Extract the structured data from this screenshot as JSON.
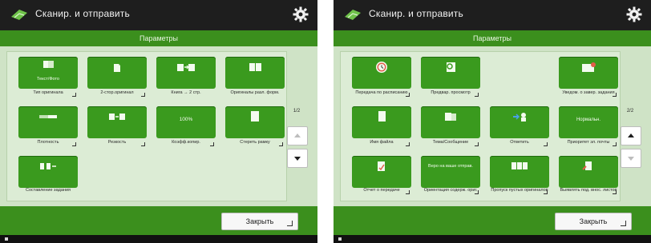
{
  "left": {
    "title": "Сканир. и отправить",
    "subtitle": "Параметры",
    "page": "1/2",
    "close": "Закрыть",
    "buttons": [
      {
        "label": "Текст/Фото",
        "caption": "Тип оригинала",
        "icon": "document-type-icon",
        "tick": true
      },
      {
        "label": "",
        "caption": "2-стор.оригинал",
        "icon": "two-sided-original-icon",
        "tick": true
      },
      {
        "label": "",
        "caption": "Книга → 2 стр.",
        "icon": "book-to-two-pages-icon",
        "tick": false
      },
      {
        "label": "",
        "caption": "Оригиналы разл. форм.",
        "icon": "mixed-size-originals-icon",
        "tick": false
      },
      {
        "label": "",
        "caption": "Плотность",
        "icon": "density-icon",
        "tick": true
      },
      {
        "label": "",
        "caption": "Резкость",
        "icon": "sharpness-icon",
        "tick": true
      },
      {
        "label": "100%",
        "caption": "Коэфф.копир.",
        "icon": "zoom-ratio-icon",
        "tick": true
      },
      {
        "label": "",
        "caption": "Стереть рамку",
        "icon": "erase-frame-icon",
        "tick": true
      },
      {
        "label": "",
        "caption": "Составление задания",
        "icon": "job-build-icon",
        "tick": false
      }
    ]
  },
  "right": {
    "title": "Сканир. и отправить",
    "subtitle": "Параметры",
    "page": "2/2",
    "close": "Закрыть",
    "buttons": [
      {
        "label": "",
        "caption": "Передача по расписанию",
        "icon": "clock-icon",
        "tick": true
      },
      {
        "label": "",
        "caption": "Предвар. просмотр",
        "icon": "preview-icon",
        "tick": true
      },
      {
        "label": "",
        "caption": "Уведом. о завер. задания",
        "icon": "notify-icon",
        "tick": true
      },
      {
        "label": "",
        "caption": "Имя файла",
        "icon": "filename-icon",
        "tick": true
      },
      {
        "label": "",
        "caption": "Тема/Сообщение",
        "icon": "subject-message-icon",
        "tick": true
      },
      {
        "label": "",
        "caption": "Ответить",
        "icon": "reply-icon",
        "tick": true
      },
      {
        "label": "Нормальн.",
        "caption": "Приоритет эл. почты",
        "icon": "priority-icon",
        "tick": true
      },
      {
        "label": "",
        "caption": "Отчет о передаче",
        "icon": "tx-report-icon",
        "tick": true
      },
      {
        "label": "Веро на ваше отправ.",
        "caption": "Ориентация содерж. ориг.",
        "icon": "orientation-icon",
        "tick": true
      },
      {
        "label": "",
        "caption": "Пропуск пустых оригиналов",
        "icon": "skip-blank-icon",
        "tick": true
      },
      {
        "label": "",
        "caption": "Выявлять под. внос. листов",
        "icon": "detect-feed-icon",
        "tick": true
      }
    ]
  },
  "colors": {
    "accent": "#3a9a1e",
    "subheader": "#3b8f1d",
    "area": "#cfe3c6"
  }
}
